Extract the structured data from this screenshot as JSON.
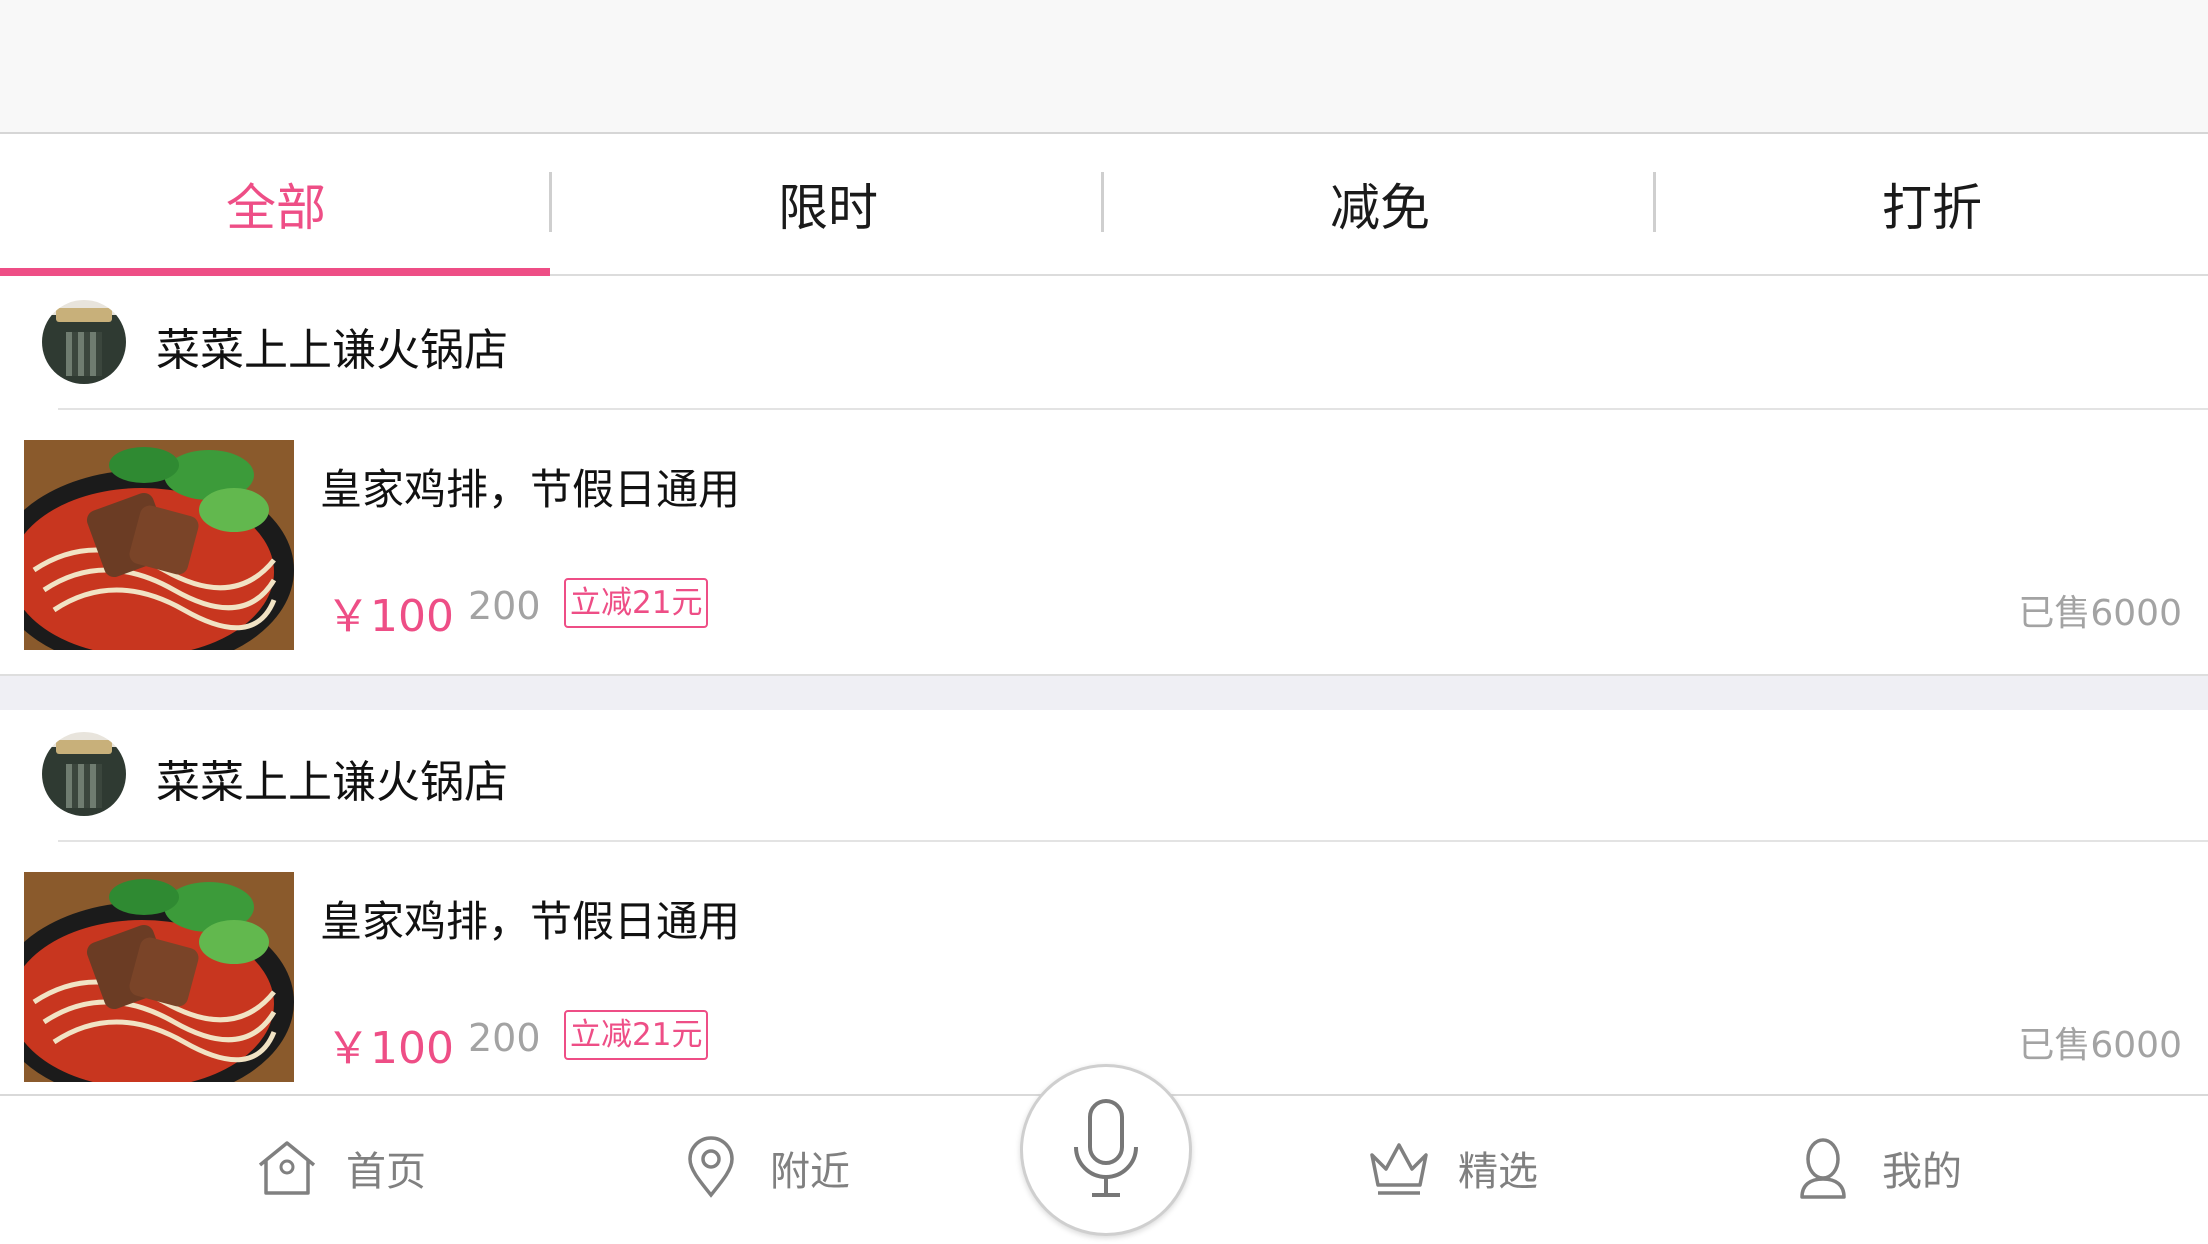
{
  "tabs": [
    {
      "label": "全部",
      "active": true
    },
    {
      "label": "限时",
      "active": false
    },
    {
      "label": "减免",
      "active": false
    },
    {
      "label": "打折",
      "active": false
    }
  ],
  "deals": [
    {
      "shop_name": "菜菜上上谦火锅店",
      "title": "皇家鸡排，节假日通用",
      "price": "￥100",
      "original_price": "200",
      "badge": "立减21元",
      "sold": "已售6000"
    },
    {
      "shop_name": "菜菜上上谦火锅店",
      "title": "皇家鸡排，节假日通用",
      "price": "￥100",
      "original_price": "200",
      "badge": "立减21元",
      "sold": "已售6000"
    }
  ],
  "bottom_nav": {
    "home": {
      "label": "首页",
      "icon": "home-icon"
    },
    "nearby": {
      "label": "附近",
      "icon": "location-pin-icon"
    },
    "voice": {
      "icon": "microphone-icon"
    },
    "featured": {
      "label": "精选",
      "icon": "crown-icon"
    },
    "mine": {
      "label": "我的",
      "icon": "user-icon"
    }
  },
  "colors": {
    "accent": "#ee4e86",
    "muted_text": "#a3a3a3",
    "nav_gray": "#808080"
  }
}
